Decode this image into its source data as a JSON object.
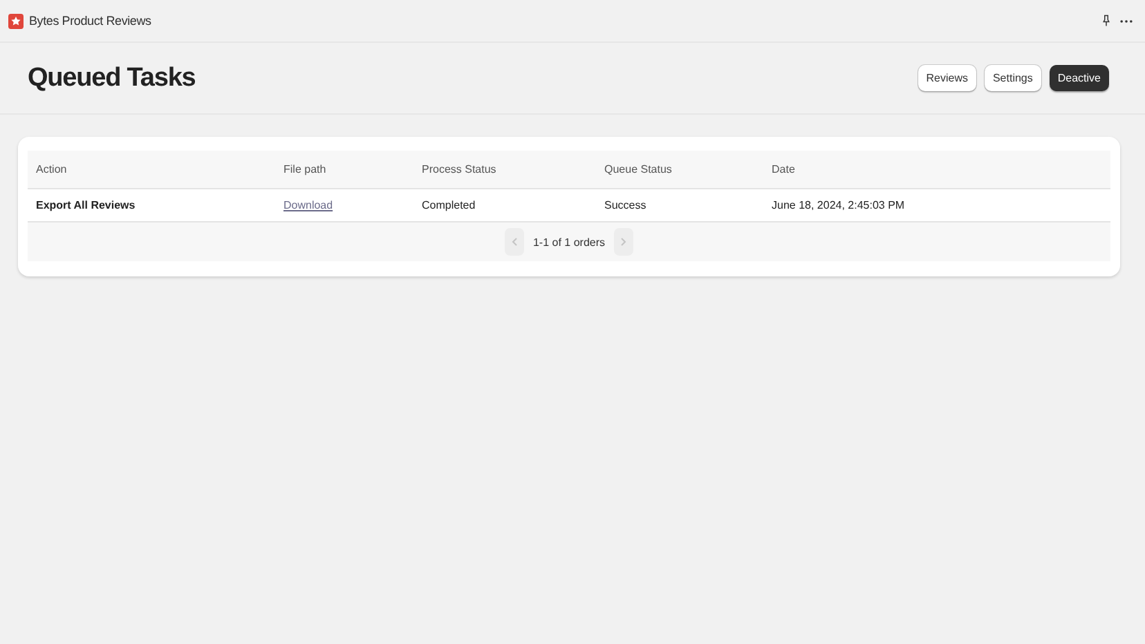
{
  "app": {
    "title": "Bytes Product Reviews"
  },
  "page": {
    "title": "Queued Tasks"
  },
  "actions": [
    {
      "label": "Reviews",
      "kind": "default"
    },
    {
      "label": "Settings",
      "kind": "default"
    },
    {
      "label": "Deactive",
      "kind": "primary"
    }
  ],
  "table": {
    "columns": [
      "Action",
      "File path",
      "Process Status",
      "Queue Status",
      "Date"
    ],
    "rows": [
      {
        "action": "Export All Reviews",
        "file_path": "Download",
        "process_status": "Completed",
        "queue_status": "Success",
        "date": "June 18, 2024, 2:45:03 PM"
      }
    ]
  },
  "pagination": {
    "label": "1-1 of 1 orders",
    "previous_disabled": true,
    "next_disabled": true
  }
}
